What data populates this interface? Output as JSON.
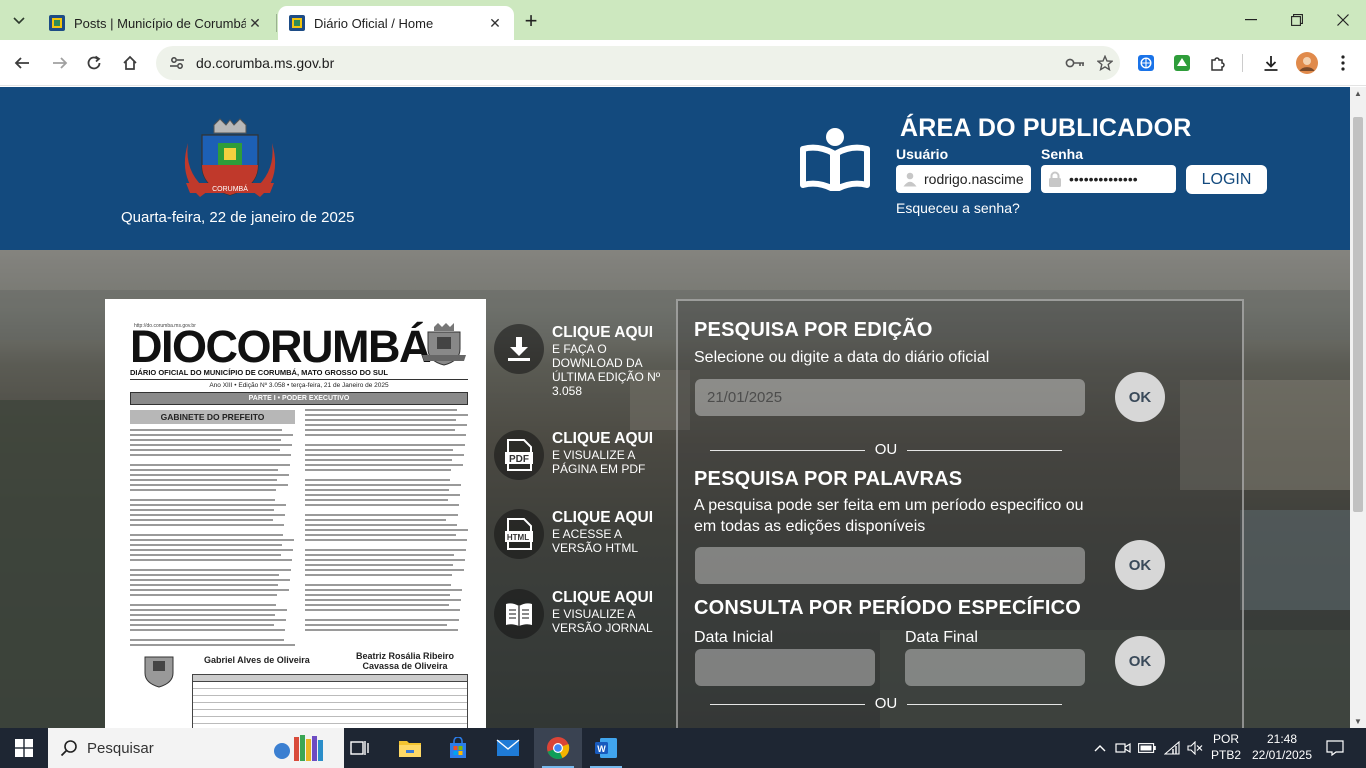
{
  "browser": {
    "tabs": [
      {
        "title": "Posts | Município de Corumbá",
        "active": false
      },
      {
        "title": "Diário Oficial / Home",
        "active": true
      }
    ],
    "url": "do.corumba.ms.gov.br"
  },
  "header": {
    "date": "Quarta-feira, 22 de janeiro de 2025",
    "publisher_title": "ÁREA DO PUBLICADOR",
    "user_label": "Usuário",
    "user_value": "rodrigo.nascime",
    "password_label": "Senha",
    "password_value": "••••••••••••••",
    "login_label": "LOGIN",
    "forgot_label": "Esqueceu a senha?"
  },
  "newspaper": {
    "site": "http://do.corumba.ms.gov.br",
    "masthead": "DIOCORUMBÁ",
    "subtitle": "DIÁRIO OFICIAL DO MUNICÍPIO DE CORUMBÁ, MATO GROSSO DO SUL",
    "edition_line": "Ano XIII  •  Edição Nº 3.058  •  terça-feira, 21 de Janeiro de 2025",
    "part": "PARTE I  •  PODER EXECUTIVO",
    "section": "GABINETE DO PREFEITO",
    "signer_1": "Gabriel Alves de Oliveira",
    "signer_2": "Beatriz Rosália Ribeiro Cavassa de Oliveira"
  },
  "actions": [
    {
      "title": "CLIQUE AQUI",
      "desc": "e faça o download da última edição nº 3.058",
      "icon": "download-icon"
    },
    {
      "title": "CLIQUE AQUI",
      "desc": "e visualize a página em PDF",
      "icon": "pdf-icon"
    },
    {
      "title": "CLIQUE AQUI",
      "desc": "e acesse a versão HTML",
      "icon": "html-icon"
    },
    {
      "title": "CLIQUE AQUI",
      "desc": "e visualize a versão jornal",
      "icon": "newspaper-icon"
    }
  ],
  "search": {
    "edition_title": "PESQUISA POR EDIÇÃO",
    "edition_text": "Selecione ou digite a data do diário oficial",
    "edition_value": "21/01/2025",
    "ok_label": "OK",
    "or_label": "OU",
    "keywords_title": "PESQUISA POR PALAVRAS",
    "keywords_text": "A pesquisa pode ser feita em um período especifico ou em todas as edições disponíveis",
    "keywords_value": "",
    "period_title": "CONSULTA POR PERÍODO ESPECÍFICO",
    "start_label": "Data Inicial",
    "end_label": "Data Final",
    "start_value": "",
    "end_value": ""
  },
  "taskbar": {
    "search_placeholder": "Pesquisar",
    "language": "POR",
    "keyboard": "PTB2",
    "time": "21:48",
    "date": "22/01/2025"
  },
  "colors": {
    "header_blue": "#134a7e",
    "tabbar_green": "#cde8bf"
  }
}
